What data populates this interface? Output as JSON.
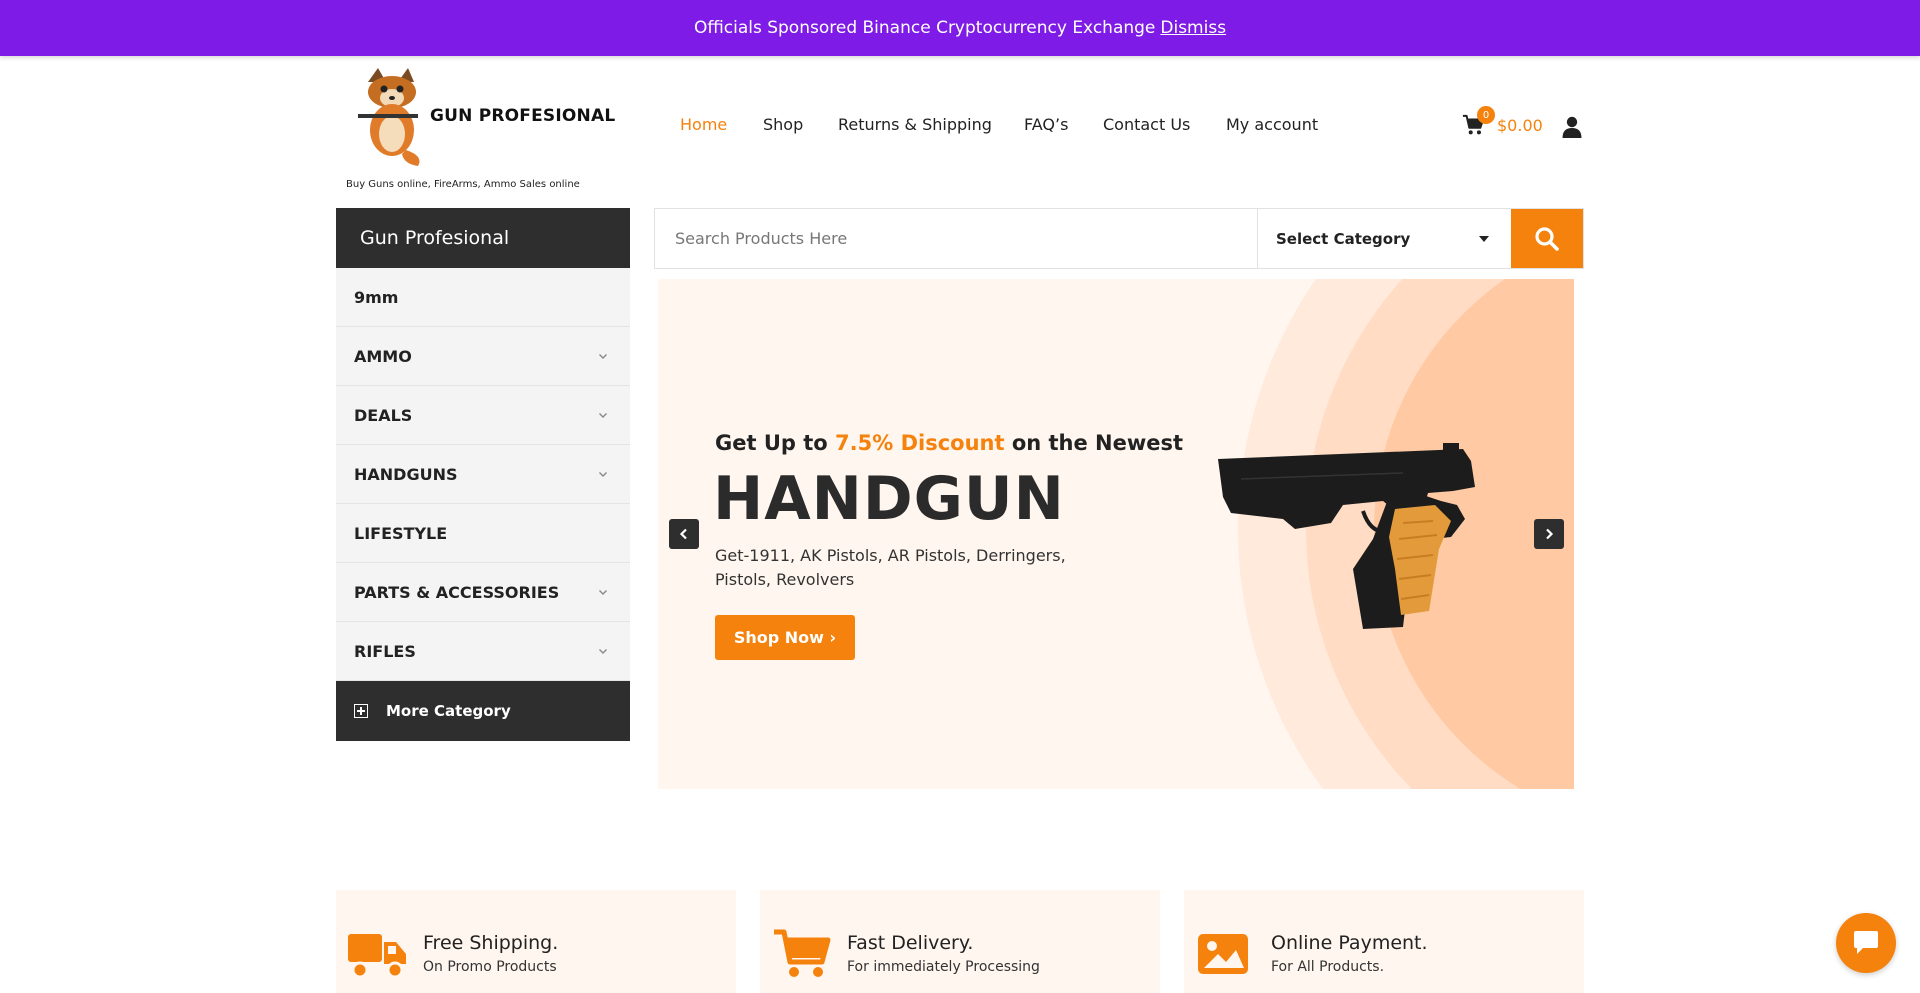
{
  "banner": {
    "text": "Officials Sponsored Binance Cryptocurrency Exchange",
    "dismiss_label": "Dismiss"
  },
  "header": {
    "logo_text": "GUN PROFESIONAL",
    "tagline": "Buy Guns online, FireArms, Ammo Sales online",
    "nav": [
      {
        "label": "Home",
        "active": true
      },
      {
        "label": "Shop"
      },
      {
        "label": "Returns & Shipping"
      },
      {
        "label": "FAQ’s"
      },
      {
        "label": "Contact Us"
      },
      {
        "label": "My account"
      }
    ],
    "cart_count": "0",
    "cart_total": "$0.00"
  },
  "sidebar": {
    "title": "Gun Profesional",
    "items": [
      {
        "label": "9mm",
        "has_children": false
      },
      {
        "label": "AMMO",
        "has_children": true
      },
      {
        "label": "DEALS",
        "has_children": true
      },
      {
        "label": "HANDGUNS",
        "has_children": true
      },
      {
        "label": "LIFESTYLE",
        "has_children": false
      },
      {
        "label": "PARTS & ACCESSORIES",
        "has_children": true
      },
      {
        "label": "RIFLES",
        "has_children": true
      }
    ],
    "more_label": "More Category"
  },
  "search": {
    "placeholder": "Search Products Here",
    "category_label": "Select Category"
  },
  "hero": {
    "sub_prefix": "Get Up to",
    "sub_accent": "7.5% Discount",
    "sub_suffix": "on the Newest",
    "title": "HANDGUN",
    "description": "Get-1911, AK Pistols, AR Pistols, Derringers, Pistols, Revolvers",
    "button_label": "Shop Now ›"
  },
  "features": [
    {
      "title": "Free Shipping.",
      "subtitle": "On Promo Products",
      "icon": "truck-icon"
    },
    {
      "title": "Fast Delivery.",
      "subtitle": "For immediately Processing",
      "icon": "cart-icon"
    },
    {
      "title": "Online Payment.",
      "subtitle": "For All Products.",
      "icon": "image-icon"
    }
  ],
  "colors": {
    "accent": "#f5820c",
    "banner": "#7f1be6",
    "dark": "#2e2e2e"
  }
}
